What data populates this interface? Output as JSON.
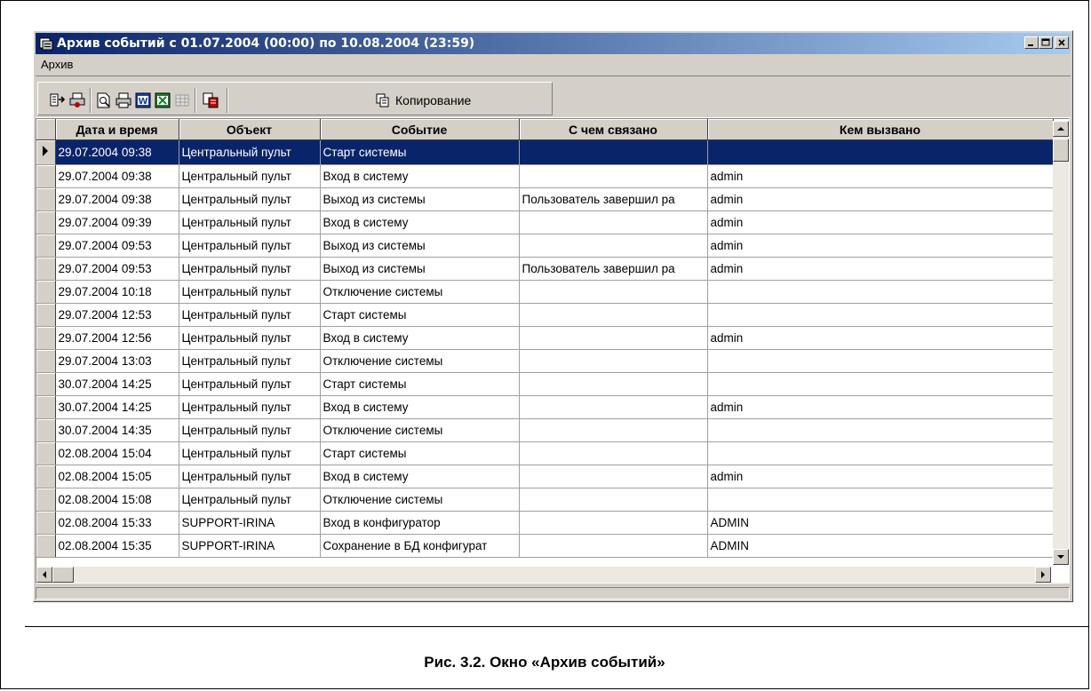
{
  "window": {
    "title": "Архив событий с 01.07.2004 (00:00) по 10.08.2004 (23:59)"
  },
  "menu": {
    "items": [
      "Архив"
    ]
  },
  "toolbar": {
    "copy_label": "Копирование"
  },
  "table": {
    "headers": [
      "Дата и время",
      "Объект",
      "Событие",
      "С чем связано",
      "Кем вызвано"
    ],
    "rows": [
      [
        "29.07.2004 09:38",
        "Центральный пульт",
        "Старт системы",
        "",
        ""
      ],
      [
        "29.07.2004 09:38",
        "Центральный пульт",
        "Вход в систему",
        "",
        "admin"
      ],
      [
        "29.07.2004 09:38",
        "Центральный пульт",
        "Выход из системы",
        "Пользователь завершил ра",
        "admin"
      ],
      [
        "29.07.2004 09:39",
        "Центральный пульт",
        "Вход в систему",
        "",
        "admin"
      ],
      [
        "29.07.2004 09:53",
        "Центральный пульт",
        "Выход из системы",
        "",
        "admin"
      ],
      [
        "29.07.2004 09:53",
        "Центральный пульт",
        "Выход из системы",
        "Пользователь завершил ра",
        "admin"
      ],
      [
        "29.07.2004 10:18",
        "Центральный пульт",
        "Отключение системы",
        "",
        ""
      ],
      [
        "29.07.2004 12:53",
        "Центральный пульт",
        "Старт системы",
        "",
        ""
      ],
      [
        "29.07.2004 12:56",
        "Центральный пульт",
        "Вход в систему",
        "",
        "admin"
      ],
      [
        "29.07.2004 13:03",
        "Центральный пульт",
        "Отключение системы",
        "",
        ""
      ],
      [
        "30.07.2004 14:25",
        "Центральный пульт",
        "Старт системы",
        "",
        ""
      ],
      [
        "30.07.2004 14:25",
        "Центральный пульт",
        "Вход в систему",
        "",
        "admin"
      ],
      [
        "30.07.2004 14:35",
        "Центральный пульт",
        "Отключение системы",
        "",
        ""
      ],
      [
        "02.08.2004 15:04",
        "Центральный пульт",
        "Старт системы",
        "",
        ""
      ],
      [
        "02.08.2004 15:05",
        "Центральный пульт",
        "Вход в систему",
        "",
        "admin"
      ],
      [
        "02.08.2004 15:08",
        "Центральный пульт",
        "Отключение системы",
        "",
        ""
      ],
      [
        "02.08.2004 15:33",
        "SUPPORT-IRINA",
        "Вход в конфигуратор",
        "",
        "ADMIN"
      ],
      [
        "02.08.2004 15:35",
        "SUPPORT-IRINA",
        "Сохранение в БД конфигурат",
        "",
        "ADMIN"
      ]
    ],
    "selected_row": 0
  },
  "caption": "Рис. 3.2. Окно «Архив событий»",
  "colors": {
    "titlebar_start": "#0a246a",
    "titlebar_end": "#a6caf0",
    "selection": "#0a246a",
    "face": "#d4d0c8"
  },
  "icons": [
    "app-icon",
    "minimize-icon",
    "maximize-icon",
    "close-icon",
    "export-icon",
    "print-setup-icon",
    "preview-icon",
    "print-icon",
    "word-icon",
    "excel-icon",
    "table-icon",
    "copy-icon"
  ]
}
